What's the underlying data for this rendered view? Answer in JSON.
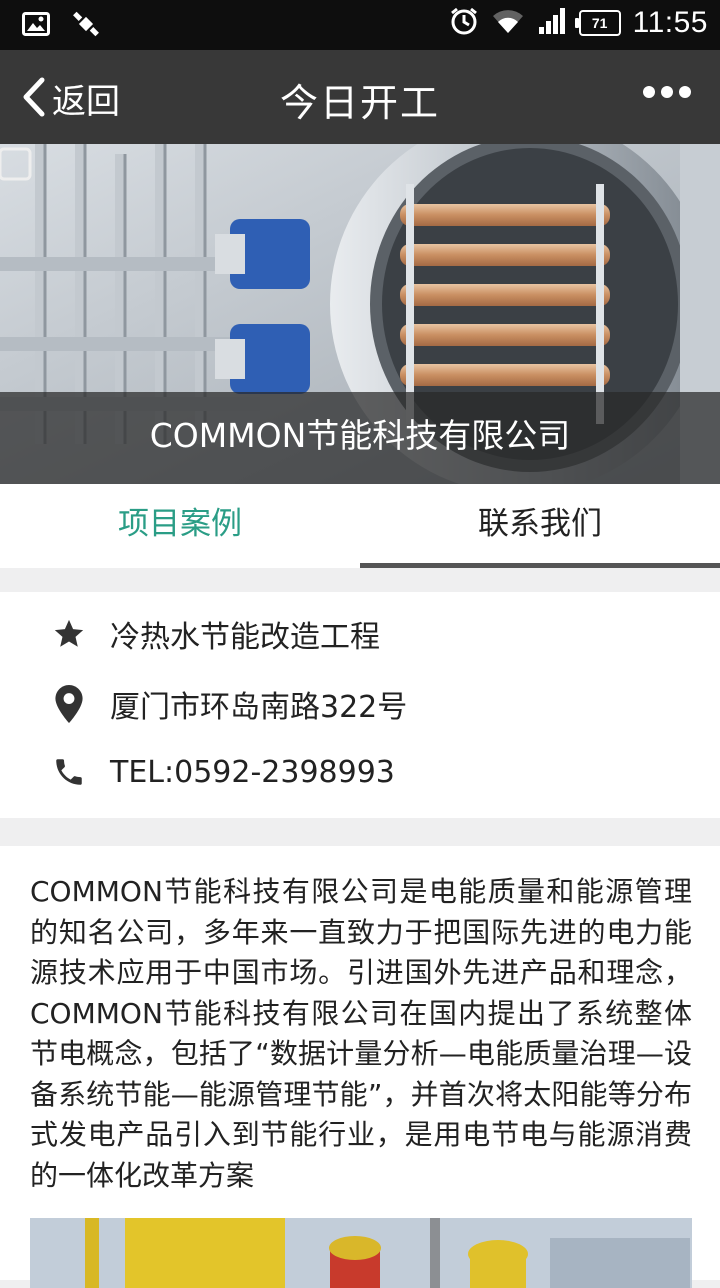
{
  "status_bar": {
    "time": "11:55",
    "battery": "71",
    "icons": [
      "image-notification-icon",
      "satellite-icon",
      "alarm-icon",
      "wifi-icon",
      "signal-icon",
      "battery-icon"
    ]
  },
  "header": {
    "back_label": "返回",
    "title": "今日开工",
    "more_icon": "more-dots-icon"
  },
  "banner": {
    "caption": "COMMON节能科技有限公司"
  },
  "tabs": [
    {
      "label": "项目案例",
      "state": "active"
    },
    {
      "label": "联系我们",
      "state": "selected"
    }
  ],
  "info": {
    "project": "冷热水节能改造工程",
    "address": "厦门市环岛南路322号",
    "phone": "TEL:0592-2398993"
  },
  "description": "COMMON节能科技有限公司是电能质量和能源管理的知名公司，多年来一直致力于把国际先进的电力能源技术应用于中国市场。引进国外先进产品和理念，COMMON节能科技有限公司在国内提出了系统整体节电概念，包括了“数据计量分析—电能质量治理—设备系统节能—能源管理节能”，并首次将太阳能等分布式发电产品引入到节能行业，是用电节电与能源消费的一体化改革方案",
  "colors": {
    "accent": "#2a9d86",
    "titlebar": "#383838",
    "statusbar": "#0e0e0e",
    "background": "#efeff0"
  }
}
